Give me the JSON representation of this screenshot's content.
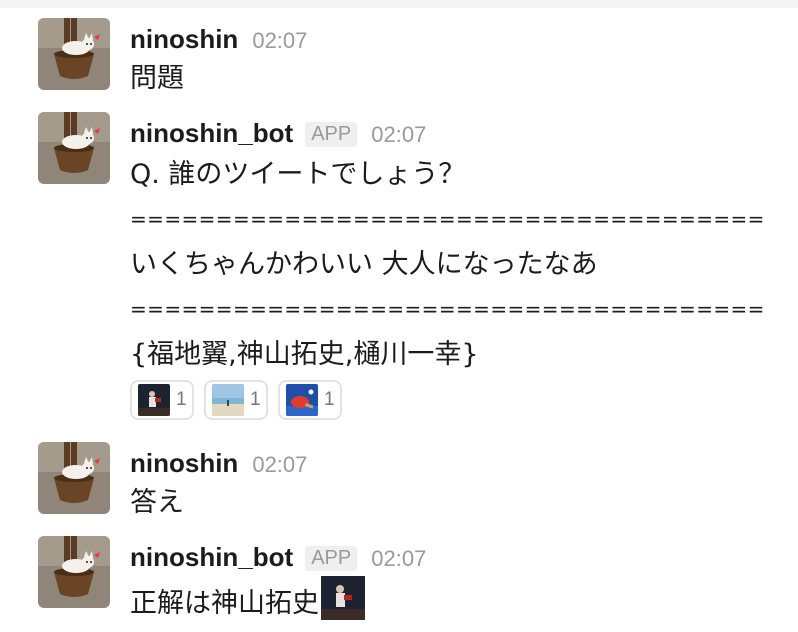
{
  "messages": [
    {
      "user": "ninoshin",
      "time": "02:07",
      "text": "問題"
    },
    {
      "user": "ninoshin_bot",
      "badge": "APP",
      "time": "02:07",
      "lines": [
        "Q. 誰のツイートでしょう？",
        "=====================================",
        "いくちゃんかわいい 大人になったなあ",
        "=====================================",
        "{福地翼,神山拓史,樋川一幸}"
      ],
      "reactions": [
        {
          "emoji": "stage-photo-emoji",
          "count": "1"
        },
        {
          "emoji": "beach-photo-emoji",
          "count": "1"
        },
        {
          "emoji": "ping-pong-emoji",
          "count": "1"
        }
      ]
    },
    {
      "user": "ninoshin",
      "time": "02:07",
      "text": "答え"
    },
    {
      "user": "ninoshin_bot",
      "badge": "APP",
      "time": "02:07",
      "text": "正解は神山拓史",
      "inline_emoji": "stage-photo-emoji"
    }
  ]
}
